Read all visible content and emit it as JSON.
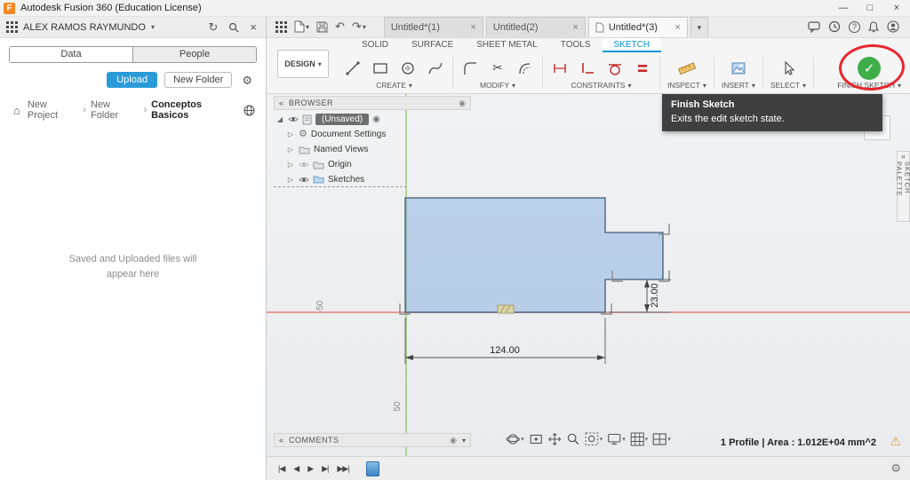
{
  "titlebar": {
    "app_initial": "F",
    "title": "Autodesk Fusion 360 (Education License)"
  },
  "icons": {
    "minimize": "—",
    "maximize": "□",
    "close_window": "×",
    "chevron_down": "▾",
    "close": "×",
    "refresh": "↻",
    "undo": "↶",
    "redo": "↷",
    "gear": "⚙",
    "home": "⌂",
    "collapse_left": "«",
    "expander": "▷",
    "expander_open": "◢",
    "radio": "◉",
    "warning": "⚠",
    "check": "✓",
    "scissors": "✂",
    "help": "?",
    "breadcrumb_separator": "›"
  },
  "data_panel": {
    "user": "ALEX RAMOS RAYMUNDO",
    "tabs": [
      "Data",
      "People"
    ],
    "upload_label": "Upload",
    "new_folder_label": "New Folder",
    "breadcrumb": [
      "New Project",
      "New Folder",
      "Conceptos Basicos"
    ],
    "empty_line1": "Saved and Uploaded files will",
    "empty_line2": "appear here"
  },
  "document_tabs": [
    {
      "label": "Untitled*(1)"
    },
    {
      "label": "Untitled(2)"
    },
    {
      "label": "Untitled*(3)"
    }
  ],
  "ribbon": {
    "workspace": "DESIGN",
    "tabs": [
      "SOLID",
      "SURFACE",
      "SHEET METAL",
      "TOOLS",
      "SKETCH"
    ],
    "active_tab": "SKETCH",
    "groups": [
      "CREATE",
      "MODIFY",
      "CONSTRAINTS",
      "INSPECT",
      "INSERT",
      "SELECT",
      "FINISH SKETCH"
    ]
  },
  "tooltip": {
    "title": "Finish Sketch",
    "body": "Exits the edit sketch state."
  },
  "browser": {
    "title": "BROWSER",
    "root": "(Unsaved)",
    "items": [
      "Document Settings",
      "Named Views",
      "Origin",
      "Sketches"
    ]
  },
  "sketch": {
    "dim_width": "124.00",
    "dim_height": "23.00",
    "axis_label_left": "-50",
    "axis_label_bottom": "50"
  },
  "comments": {
    "title": "COMMENTS"
  },
  "sketch_palette": {
    "label": "SKETCH PALETTE"
  },
  "status": {
    "text": "1 Profile | Area : 1.012E+04 mm^2"
  },
  "timeline": {
    "controls": [
      "|◀",
      "◀",
      "▶",
      "▶|",
      "▶▶|"
    ]
  },
  "colors": {
    "accent": "#0696d7",
    "upload-blue": "#2a9bd8",
    "finish-green": "#3fae49",
    "annotation-red": "#e8262d",
    "axis-green": "#9bc779",
    "axis-red": "#dd8078",
    "sketch-fill": "#7aa6dc",
    "tooltip-bg": "#3f3f3f"
  }
}
